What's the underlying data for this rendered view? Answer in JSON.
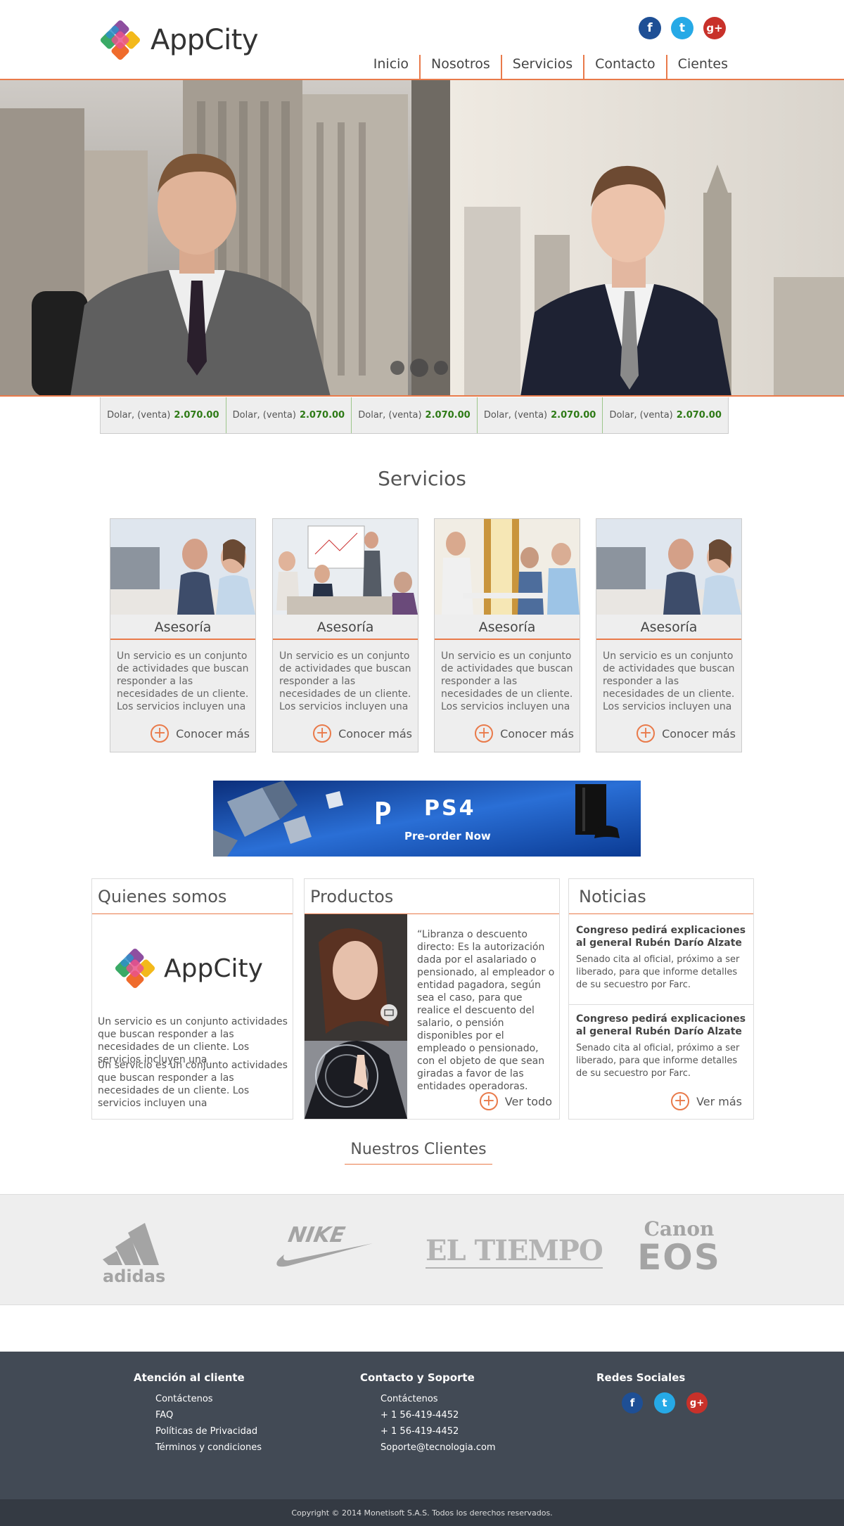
{
  "brand": {
    "name": "AppCity"
  },
  "social": [
    "f",
    "t",
    "g+"
  ],
  "nav": [
    "Inicio",
    "Nosotros",
    "Servicios",
    "Contacto",
    "Cientes"
  ],
  "ticker": [
    {
      "label": "Dolar, (venta)",
      "value": "2.070.00"
    },
    {
      "label": "Dolar, (venta)",
      "value": "2.070.00"
    },
    {
      "label": "Dolar, (venta)",
      "value": "2.070.00"
    },
    {
      "label": "Dolar, (venta)",
      "value": "2.070.00"
    },
    {
      "label": "Dolar, (venta)",
      "value": "2.070.00"
    }
  ],
  "services": {
    "title": "Servicios",
    "cards": [
      {
        "title": "Asesoría",
        "text": "Un servicio es un conjunto de actividades que buscan responder a las necesidades de un cliente. Los servicios incluyen una",
        "link": "Conocer más"
      },
      {
        "title": "Asesoría",
        "text": "Un servicio es un conjunto de actividades que buscan responder a las necesidades de un cliente. Los servicios incluyen una",
        "link": "Conocer más"
      },
      {
        "title": "Asesoría",
        "text": "Un servicio es un conjunto de actividades que buscan responder a las necesidades de un cliente. Los servicios incluyen una",
        "link": "Conocer más"
      },
      {
        "title": "Asesoría",
        "text": "Un servicio es un conjunto de actividades que buscan responder a las necesidades de un cliente. Los servicios incluyen una",
        "link": "Conocer más"
      }
    ]
  },
  "banner": {
    "brand": "PS4",
    "cta": "Pre-order Now"
  },
  "quienes": {
    "title": "Quienes somos",
    "logo_text": "AppCity",
    "paragraphs": [
      "Un servicio es un conjunto actividades que buscan responder a las necesidades de un cliente. Los servicios incluyen una",
      "Un servicio es un conjunto actividades que buscan responder a las necesidades de un cliente. Los servicios incluyen una"
    ]
  },
  "productos": {
    "title": "Productos",
    "text": "“Libranza o descuento directo: Es la autorización dada por el asalariado o pensionado, al empleador o entidad pagadora, según sea el caso, para que realice el descuento del salario, o pensión disponibles por el empleado o pensionado, con el objeto de que sean giradas a favor de las entidades operadoras.",
    "link": "Ver todo"
  },
  "noticias": {
    "title": "Noticias",
    "items": [
      {
        "headline": "Congreso pedirá explicaciones al general Rubén Darío Alzate",
        "body": "Senado cita al oficial, próximo a ser liberado, para que informe detalles de su secuestro por Farc."
      },
      {
        "headline": "Congreso pedirá explicaciones al general Rubén Darío Alzate",
        "body": "Senado cita al oficial, próximo a ser liberado, para que informe detalles de su secuestro por Farc."
      }
    ],
    "link": "Ver más"
  },
  "clients": {
    "title": "Nuestros Clientes",
    "logos": [
      "adidas",
      "NIKE",
      "EL TIEMPO",
      "Canon",
      "EOS"
    ]
  },
  "footer": {
    "col1": {
      "title": "Atención al cliente",
      "items": [
        "Contáctenos",
        "FAQ",
        "Políticas de Privacidad",
        "Términos y condiciones"
      ]
    },
    "col2": {
      "title": "Contacto y Soporte",
      "items": [
        "Contáctenos",
        "+ 1 56-419-4452",
        "+ 1 56-419-4452",
        "Soporte@tecnologia.com"
      ]
    },
    "col3": {
      "title": "Redes Sociales"
    },
    "copyright": "Copyright © 2014 Monetisoft S.A.S. Todos los derechos reservados."
  },
  "colors": {
    "accent": "#e97a4a",
    "footer": "#424a55",
    "ticker_value": "#2e7a16"
  }
}
